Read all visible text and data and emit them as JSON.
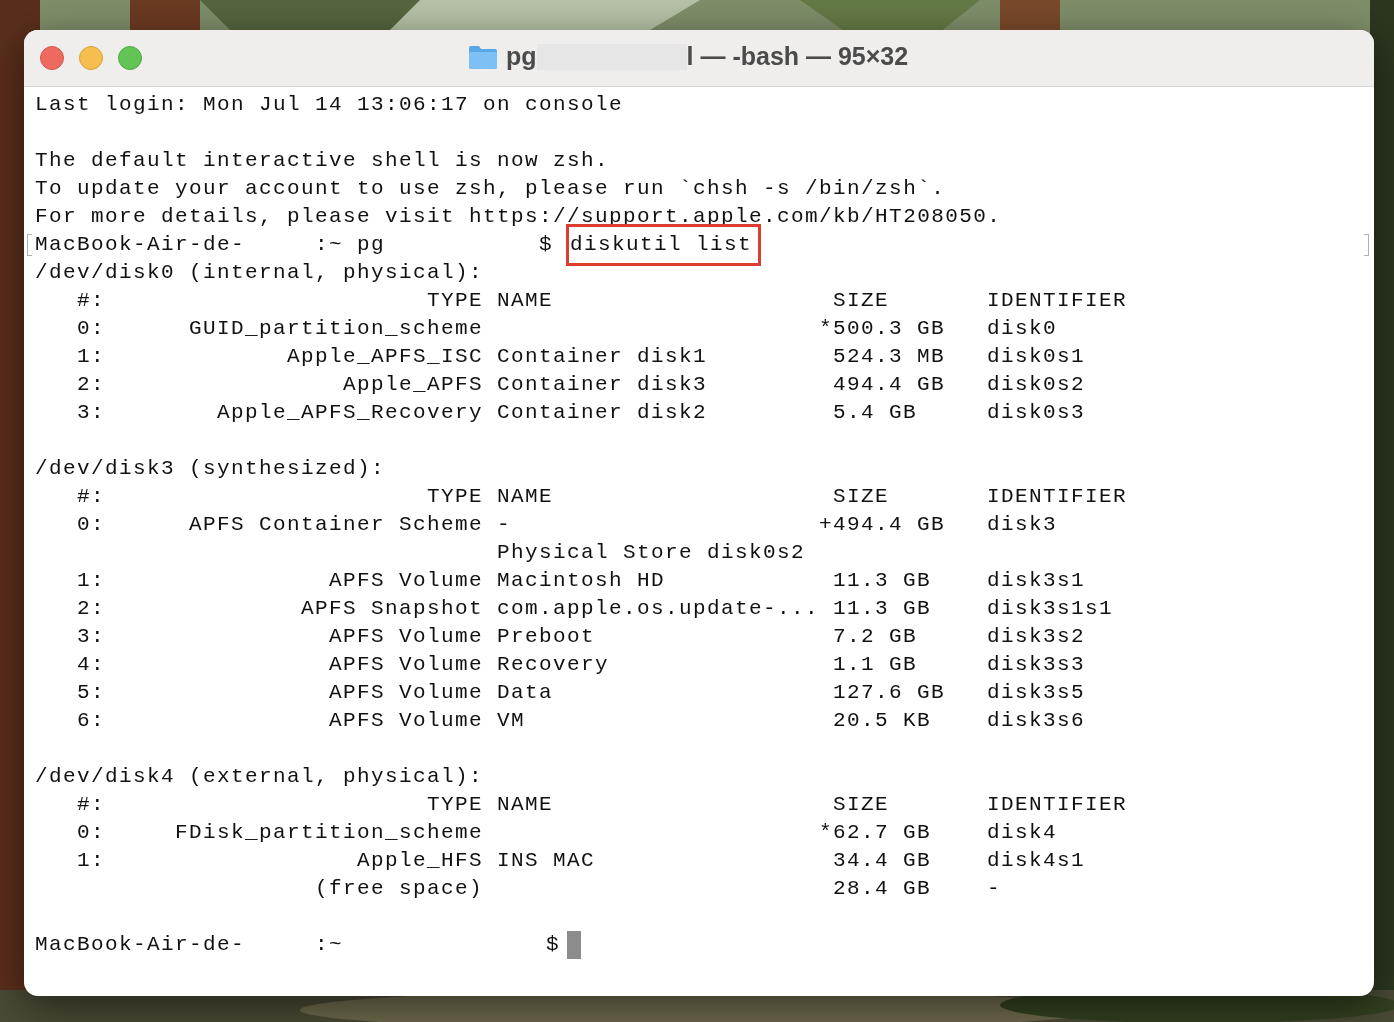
{
  "window": {
    "title": {
      "prefix": "pg",
      "redacted": true,
      "suffix": "l — -bash — 95×32"
    }
  },
  "terminal": {
    "login": "Last login: Mon Jul 14 13:06:17 on console",
    "messages": [
      "The default interactive shell is now zsh.",
      "To update your account to use zsh, please run `chsh -s /bin/zsh`.",
      "For more details, please visit https://support.apple.com/kb/HT208050."
    ],
    "prompt": {
      "host": "MacBook-Air-de-",
      "path": ":~ pg",
      "symbol": "$",
      "command": "diskutil list",
      "highlighted": true,
      "bookmarked": true
    },
    "disks": [
      {
        "device": "/dev/disk0 (internal, physical):",
        "header": {
          "num": "#:",
          "type": "TYPE",
          "name": "NAME",
          "size": "SIZE",
          "identifier": "IDENTIFIER"
        },
        "rows": [
          {
            "num": "0:",
            "type": "GUID_partition_scheme",
            "size_mark": "*",
            "size": "500.3 GB",
            "identifier": "disk0"
          },
          {
            "num": "1:",
            "type": "Apple_APFS_ISC",
            "name": "Container disk1",
            "size": "524.3 MB",
            "identifier": "disk0s1"
          },
          {
            "num": "2:",
            "type": "Apple_APFS",
            "name": "Container disk3",
            "size": "494.4 GB",
            "identifier": "disk0s2"
          },
          {
            "num": "3:",
            "type": "Apple_APFS_Recovery",
            "name": "Container disk2",
            "size": "5.4 GB",
            "identifier": "disk0s3"
          }
        ]
      },
      {
        "device": "/dev/disk3 (synthesized):",
        "header": {
          "num": "#:",
          "type": "TYPE",
          "name": "NAME",
          "size": "SIZE",
          "identifier": "IDENTIFIER"
        },
        "rows": [
          {
            "num": "0:",
            "type": "APFS Container Scheme",
            "name": "-",
            "size_mark": "+",
            "size": "494.4 GB",
            "identifier": "disk3"
          },
          {
            "name": "Physical Store disk0s2"
          },
          {
            "num": "1:",
            "type": "APFS Volume",
            "name": "Macintosh HD",
            "size": "11.3 GB",
            "identifier": "disk3s1"
          },
          {
            "num": "2:",
            "type": "APFS Snapshot",
            "name": "com.apple.os.update-...",
            "size": "11.3 GB",
            "identifier": "disk3s1s1"
          },
          {
            "num": "3:",
            "type": "APFS Volume",
            "name": "Preboot",
            "size": "7.2 GB",
            "identifier": "disk3s2"
          },
          {
            "num": "4:",
            "type": "APFS Volume",
            "name": "Recovery",
            "size": "1.1 GB",
            "identifier": "disk3s3"
          },
          {
            "num": "5:",
            "type": "APFS Volume",
            "name": "Data",
            "size": "127.6 GB",
            "identifier": "disk3s5"
          },
          {
            "num": "6:",
            "type": "APFS Volume",
            "name": "VM",
            "size": "20.5 KB",
            "identifier": "disk3s6"
          }
        ]
      },
      {
        "device": "/dev/disk4 (external, physical):",
        "header": {
          "num": "#:",
          "type": "TYPE",
          "name": "NAME",
          "size": "SIZE",
          "identifier": "IDENTIFIER"
        },
        "rows": [
          {
            "num": "0:",
            "type": "FDisk_partition_scheme",
            "size_mark": "*",
            "size": "62.7 GB",
            "identifier": "disk4"
          },
          {
            "num": "1:",
            "type": "Apple_HFS",
            "name": "INS MAC",
            "size": "34.4 GB",
            "identifier": "disk4s1"
          },
          {
            "type": "(free space)",
            "size": "28.4 GB",
            "identifier": "-"
          }
        ]
      }
    ],
    "final_prompt": {
      "host": "MacBook-Air-de-",
      "path": ":~",
      "symbol": "$",
      "cursor": true
    }
  }
}
